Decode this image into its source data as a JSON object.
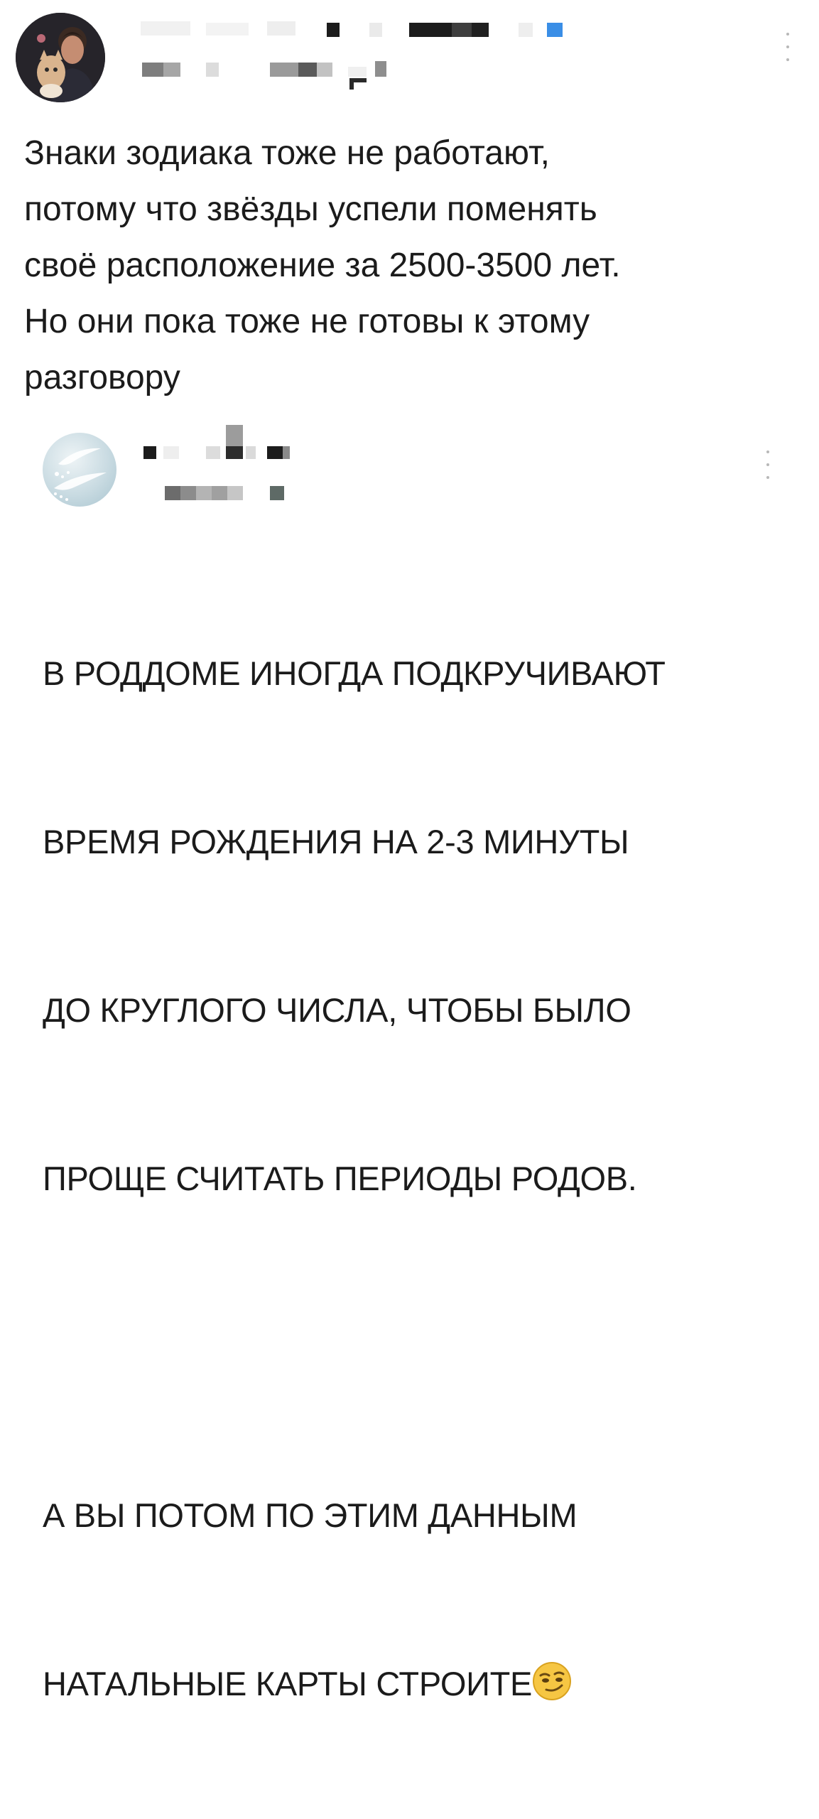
{
  "posts": [
    {
      "text": "Знаки зодиака тоже не работают,\nпотому что звёзды успели поменять\nсвоё расположение за 2500-3500 лет.\nНо они пока тоже не готовы к этому\nразговору",
      "avatar_icon": "user-photo-avatar",
      "menu_icon": "vertical-ellipsis-icon"
    },
    {
      "text_lines": [
        "В РОДДОМЕ ИНОГДА ПОДКРУЧИВАЮТ",
        "ВРЕМЯ РОЖДЕНИЯ НА 2-3 МИНУТЫ",
        "ДО КРУГЛОГО ЧИСЛА, ЧТОБЫ БЫЛО",
        "ПРОЩЕ СЧИТАТЬ ПЕРИОДЫ РОДОВ.",
        "",
        "А ВЫ ПОТОМ ПО ЭТИМ ДАННЫМ",
        "НАТАЛЬНЫЕ КАРТЫ СТРОИТЕ"
      ],
      "emoji": "smirking-face-emoji",
      "avatar_icon": "water-drops-avatar",
      "menu_icon": "vertical-ellipsis-icon"
    }
  ],
  "colors": {
    "text": "#1b1b1b",
    "redacted_dark": "#1a1a1a",
    "redacted_blue": "#3a8ee6",
    "emoji_face": "#f6c643"
  }
}
